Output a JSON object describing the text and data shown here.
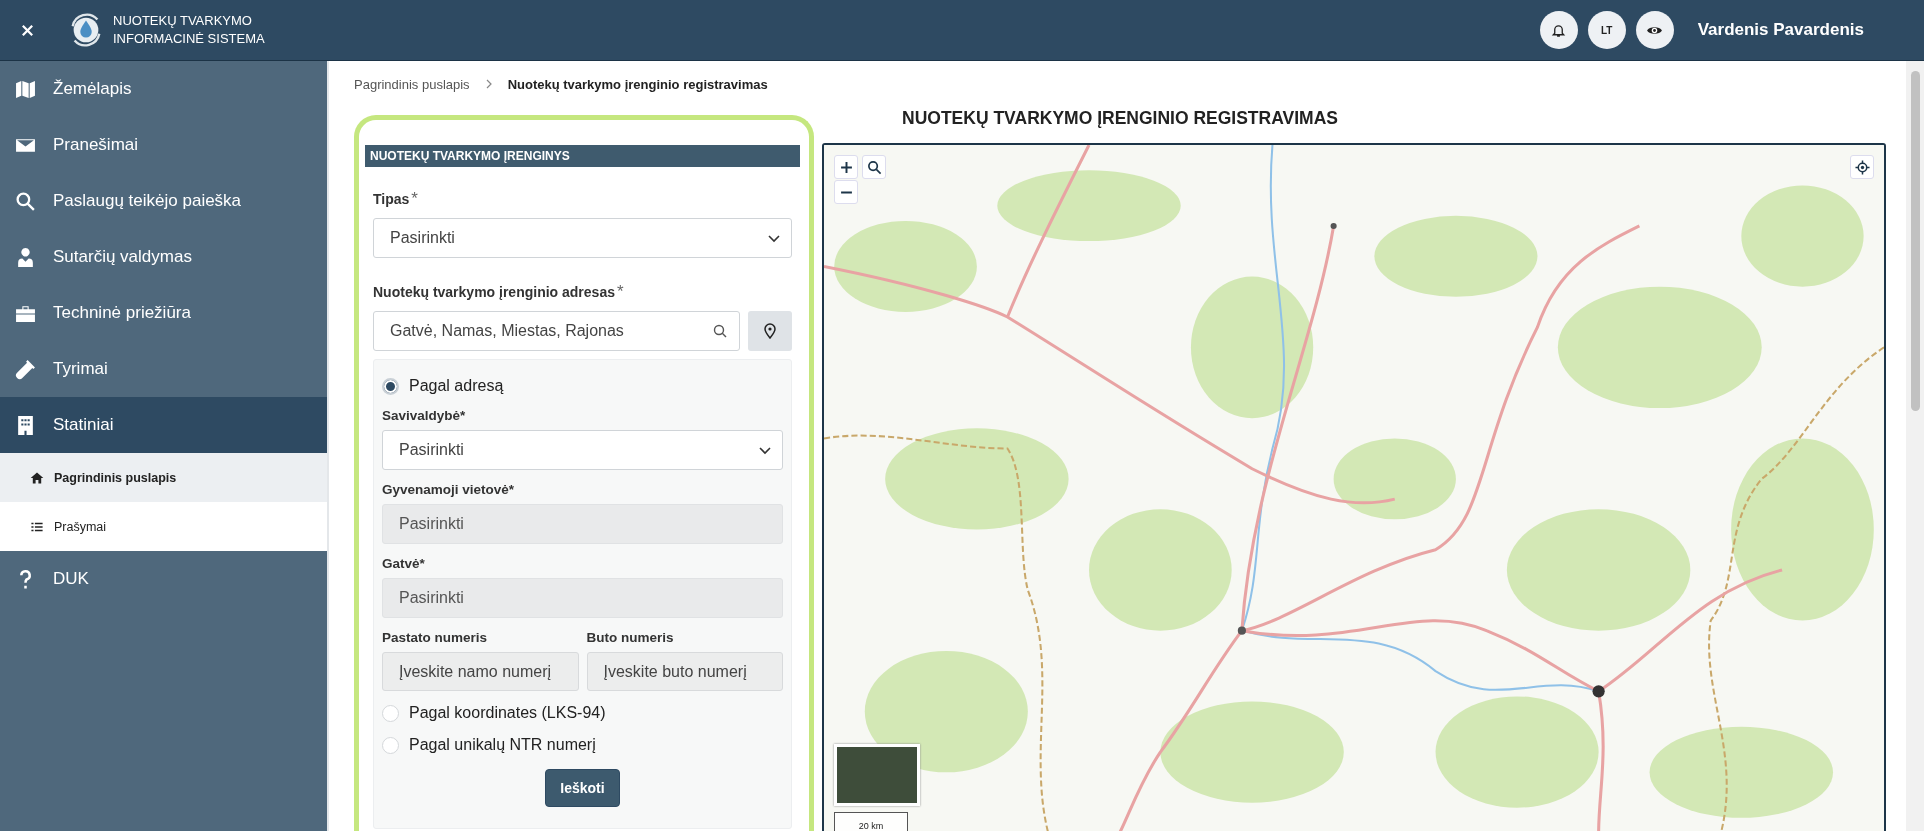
{
  "header": {
    "app_title": [
      "NUOTEKŲ TVARKYMO",
      "INFORMACINĖ SISTEMA"
    ],
    "language": "LT",
    "user_name": "Vardenis Pavardenis"
  },
  "sidebar": {
    "items": [
      {
        "label": "Žemėlapis",
        "selected": false
      },
      {
        "label": "Pranešimai",
        "selected": false
      },
      {
        "label": "Paslaugų teikėjo paieška",
        "selected": false
      },
      {
        "label": "Sutarčių valdymas",
        "selected": false
      },
      {
        "label": "Techninė priežiūra",
        "selected": false
      },
      {
        "label": "Tyrimai",
        "selected": false
      },
      {
        "label": "Statiniai",
        "selected": true,
        "expanded": true,
        "children": [
          {
            "label": "Pagrindinis puslapis",
            "selected": true
          },
          {
            "label": "Prašymai",
            "selected": false
          }
        ]
      },
      {
        "label": "DUK",
        "selected": false
      }
    ]
  },
  "breadcrumb": [
    {
      "label": "Pagrindinis puslapis",
      "current": false
    },
    {
      "label": "Nuotekų tvarkymo įrenginio registravimas",
      "current": true
    }
  ],
  "page_title": "NUOTEKŲ TVARKYMO ĮRENGINIO REGISTRAVIMAS",
  "form": {
    "section_title": "NUOTEKŲ TVARKYMO ĮRENGINYS",
    "type_field": {
      "label": "Tipas",
      "required_mark": "*",
      "placeholder": "Pasirinkti"
    },
    "address_field": {
      "label": "Nuotekų tvarkymo įrenginio adresas",
      "required_mark": "*",
      "placeholder": "Gatvė, Namas, Miestas, Rajonas"
    },
    "search_modes": [
      {
        "label": "Pagal adresą",
        "selected": true,
        "fields": [
          {
            "kind": "select",
            "label": "Savivaldybė*",
            "placeholder": "Pasirinkti",
            "disabled": false
          },
          {
            "kind": "select",
            "label": "Gyvenamoji vietovė*",
            "placeholder": "Pasirinkti",
            "disabled": true
          },
          {
            "kind": "select",
            "label": "Gatvė*",
            "placeholder": "Pasirinkti",
            "disabled": true
          },
          {
            "kind": "text",
            "label": "Pastato numeris",
            "placeholder": "Įveskite namo numerį",
            "disabled": true
          },
          {
            "kind": "text",
            "label": "Buto numeris",
            "placeholder": "Įveskite buto numerį",
            "disabled": true
          }
        ]
      },
      {
        "label": "Pagal koordinates (LKS-94)",
        "selected": false
      },
      {
        "label": "Pagal unikalų NTR numerį",
        "selected": false
      }
    ],
    "submit_button": "Ieškoti"
  },
  "map": {
    "scale_label": "20 km"
  }
}
